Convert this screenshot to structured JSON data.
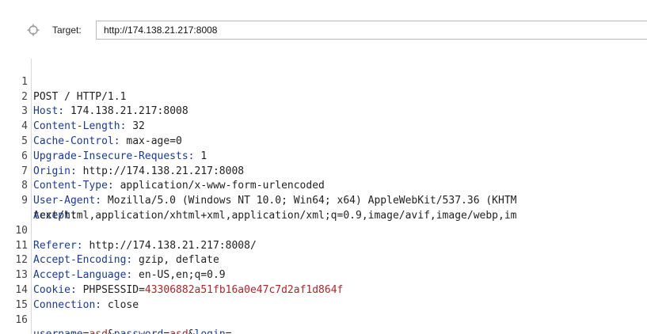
{
  "target": {
    "label": "Target:",
    "url": "http://174.138.21.217:8008"
  },
  "request": {
    "request_line": "POST / HTTP/1.1",
    "headers": [
      {
        "num": "2",
        "name": "Host:",
        "value": " 174.138.21.217:8008"
      },
      {
        "num": "3",
        "name": "Content-Length:",
        "value": " 32"
      },
      {
        "num": "4",
        "name": "Cache-Control:",
        "value": " max-age=0"
      },
      {
        "num": "5",
        "name": "Upgrade-Insecure-Requests:",
        "value": " 1"
      },
      {
        "num": "6",
        "name": "Origin:",
        "value": " http://174.138.21.217:8008"
      },
      {
        "num": "7",
        "name": "Content-Type:",
        "value": " application/x-www-form-urlencoded"
      },
      {
        "num": "8",
        "name": "User-Agent:",
        "value": " Mozilla/5.0 (Windows NT 10.0; Win64; x64) AppleWebKit/537.36 (KHTM"
      }
    ],
    "accept": {
      "num": "9",
      "name": "Accept:",
      "continuation": "text/html,application/xhtml+xml,application/xml;q=0.9,image/avif,image/webp,im"
    },
    "headers_after": [
      {
        "num": "10",
        "name": "Referer:",
        "value": " http://174.138.21.217:8008/"
      },
      {
        "num": "11",
        "name": "Accept-Encoding:",
        "value": " gzip, deflate"
      },
      {
        "num": "12",
        "name": "Accept-Language:",
        "value": " en-US,en;q=0.9"
      }
    ],
    "cookie": {
      "num": "13",
      "name": "Cookie:",
      "cookie_name": " PHPSESSID",
      "eq": "=",
      "cookie_value": "43306882a51fb16a0e47c7d2af1d864f"
    },
    "connection": {
      "num": "14",
      "name": "Connection:",
      "value": " close"
    },
    "blank_num": "15",
    "body": {
      "num": "16",
      "p1_name": "username",
      "p1_eq": "=",
      "p1_value": "asd",
      "amp1": "&",
      "p2_name": "password",
      "p2_eq": "=",
      "p2_value": "asd",
      "amp2": "&",
      "p3_name": "login",
      "p3_eq": "="
    }
  },
  "colors": {
    "header_name": "#1a3a9c",
    "param_value": "#b0252b"
  },
  "icons": {
    "target_icon": "crosshair-icon"
  }
}
